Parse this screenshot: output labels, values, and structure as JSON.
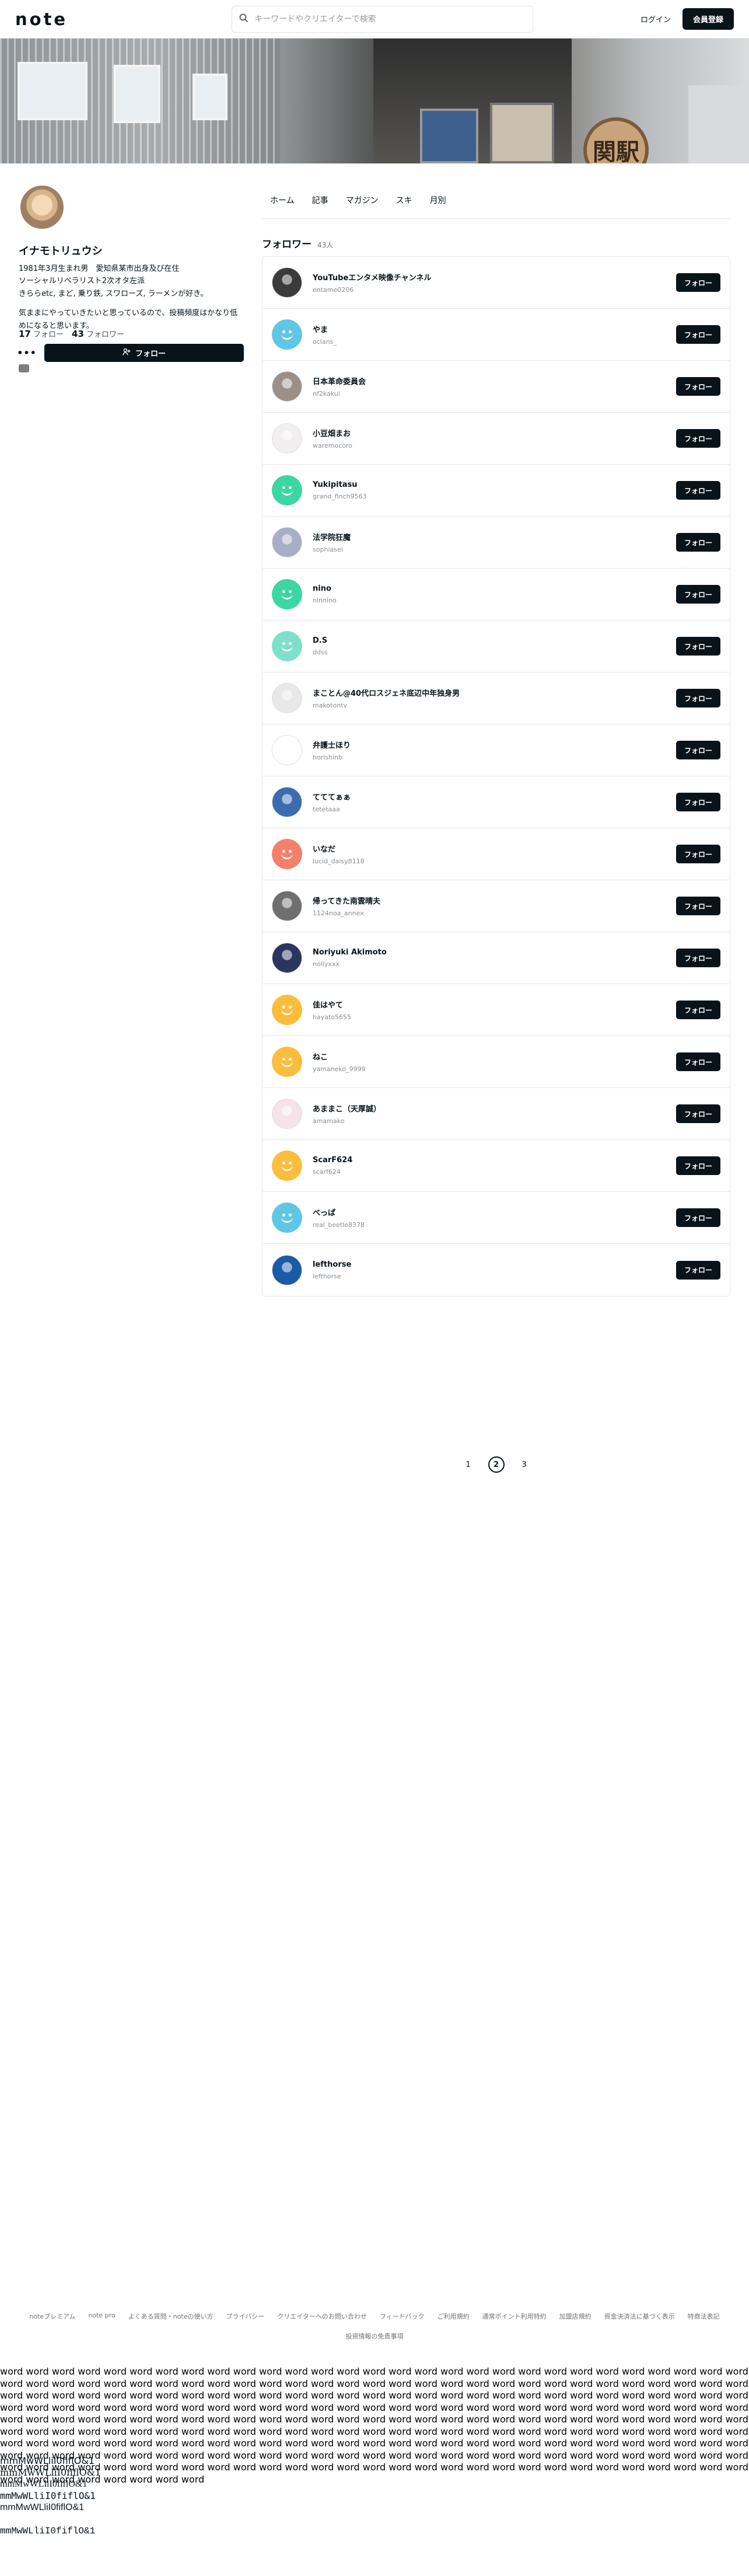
{
  "header": {
    "logo": "note",
    "search_placeholder": "キーワードやクリエイターで検索",
    "login": "ログイン",
    "signup": "会員登録"
  },
  "banner": {
    "sign_text": "関駅"
  },
  "profile": {
    "name": "イナモトリュウシ",
    "bio": [
      "1981年3月生まれ男　愛知県某市出身及び在住",
      "ソーシャルリベラリスト2次オタ左派",
      "きららetc, まど, 乗り鉄, スワローズ, ラーメンが好き。",
      "気ままにやっていきたいと思っているので、投稿頻度はかなり低めになると思います。"
    ],
    "following_count": "17",
    "following_label": "フォロー",
    "followers_count": "43",
    "followers_label": "フォロワー",
    "more": "•••",
    "follow_button": "フォロー"
  },
  "tabs": [
    "ホーム",
    "記事",
    "マガジン",
    "スキ",
    "月別"
  ],
  "section": {
    "title": "フォロワー",
    "count": "43人"
  },
  "follow_label": "フォロー",
  "followers": [
    {
      "name": "YouTubeエンタメ映像チャンネル",
      "id": "entame0206",
      "avatar": "photo-dark",
      "color": "#3b3b3b"
    },
    {
      "name": "やま",
      "id": "oclans_",
      "avatar": "smile",
      "color": "#5fc7e3"
    },
    {
      "name": "日本革命委員会",
      "id": "nf2kakui",
      "avatar": "photo",
      "color": "#9b8f8a"
    },
    {
      "name": "小豆畑まお",
      "id": "waremocoro",
      "avatar": "illust",
      "color": "#f1eef0"
    },
    {
      "name": "Yukipitasu",
      "id": "grand_finch9563",
      "avatar": "smile",
      "color": "#3cd6a2"
    },
    {
      "name": "法学院狂魔",
      "id": "sophiasei",
      "avatar": "illust",
      "color": "#a7aec5"
    },
    {
      "name": "nino",
      "id": "ninnino",
      "avatar": "smile",
      "color": "#3cd6a2"
    },
    {
      "name": "D.S",
      "id": "ddss",
      "avatar": "smile",
      "color": "#7fe0c9"
    },
    {
      "name": "まことん@40代ロスジェネ底辺中年独身男",
      "id": "makotontv",
      "avatar": "photo",
      "color": "#e8e8e8"
    },
    {
      "name": "弁護士ほり",
      "id": "horishinb",
      "avatar": "illust",
      "color": "#ffffff"
    },
    {
      "name": "てててぁぁ",
      "id": "tetetaaa",
      "avatar": "photo",
      "color": "#3a6db0"
    },
    {
      "name": "いなだ",
      "id": "lucid_daisy8118",
      "avatar": "smile",
      "color": "#f4806b"
    },
    {
      "name": "帰ってきた南雲晴夫",
      "id": "1124noa_annex",
      "avatar": "photo",
      "color": "#6f6f6f"
    },
    {
      "name": "Noriyuki Akimoto",
      "id": "nollyxxx",
      "avatar": "photo",
      "color": "#2c3560"
    },
    {
      "name": "佳はやて",
      "id": "hayato5655",
      "avatar": "smile",
      "color": "#fbbd3c"
    },
    {
      "name": "ねこ",
      "id": "yamaneko_9999",
      "avatar": "smile",
      "color": "#fbbd3c"
    },
    {
      "name": "あままこ（天厚誠）",
      "id": "amamako",
      "avatar": "illust",
      "color": "#f6e3ea"
    },
    {
      "name": "ScarF624",
      "id": "scarf624",
      "avatar": "smile",
      "color": "#fbbd3c"
    },
    {
      "name": "べっぱ",
      "id": "real_beetle8378",
      "avatar": "smile",
      "color": "#5fc7e3"
    },
    {
      "name": "lefthorse",
      "id": "lefthorse",
      "avatar": "illust",
      "color": "#1b5aa6"
    }
  ],
  "pagination": {
    "pages": [
      "1",
      "2",
      "3"
    ],
    "current": "2"
  },
  "footer": {
    "links": [
      "noteプレミアム",
      "note pro",
      "よくある質問・noteの使い方",
      "プライバシー",
      "クリエイターへのお問い合わせ",
      "フィードバック",
      "ご利用規約",
      "通常ポイント利用特約",
      "加盟店規約",
      "資金決済法に基づく表示",
      "特商法表記"
    ],
    "links2": "投資情報の免責事項"
  },
  "filler": {
    "words": "word word word word word word word word word word word word word word word word word word word word word word word word word word word word word word word word word word word word word word word word word word word word word word word word word word word word word word word word word word word word word word word word word word word word word word word word word word word word word word word word word word word word word word word word word word word word word word word word word word word word word word word word word word word word word word word word word word word word word word word word word word word word word word word word word word word word word word word word word word word word word word word word word word word word word word word word word word word word word word word word word word word word word word word word word word word word word word word word word word word word word word word word word word word word word word word word word word word word word word word word word word word word word word word word word word word word word word word word word word word word word word word word word word word word word word word word word word word word word word word word word word word word word word word word word word word word word word word word word word word word word word word word word word word word word",
    "mono_lines": [
      "mmMwWLliI0fiflO&1",
      "mmMwWLliI0fiflO&1",
      "mmMwWLliI0fiflO&1",
      "mmMwWLliI0fiflO&1",
      "mmMwWLliI0fiflO&1",
      "",
      "mmMwWLliI0fiflO&1"
    ]
  }
}
